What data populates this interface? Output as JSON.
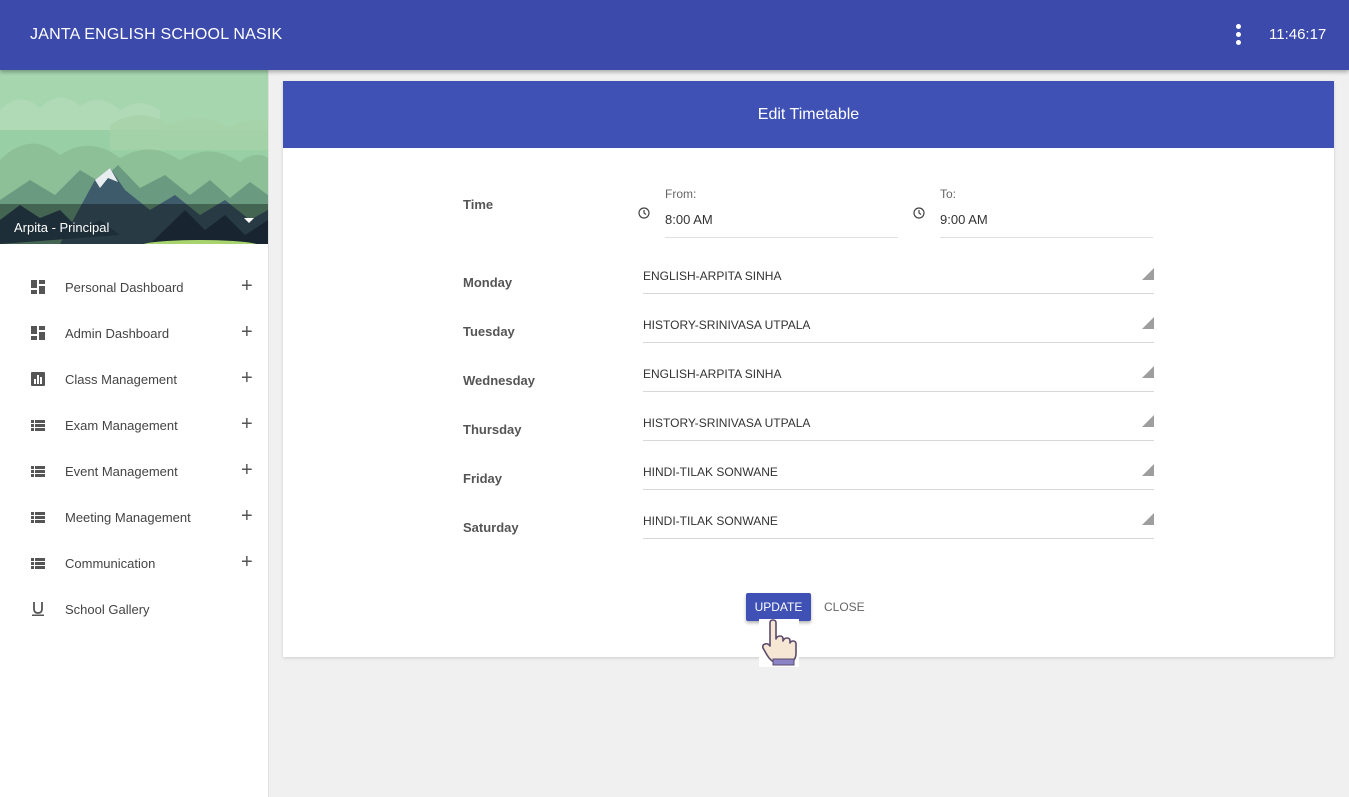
{
  "app": {
    "title": "JANTA ENGLISH SCHOOL NASIK",
    "time": "11:46:17"
  },
  "profile": {
    "name": "Arpita - Principal"
  },
  "sidebar": {
    "items": [
      {
        "label": "Personal Dashboard",
        "icon": "dashboard-icon",
        "expandable": true
      },
      {
        "label": "Admin Dashboard",
        "icon": "dashboard-grid-icon",
        "expandable": true
      },
      {
        "label": "Class Management",
        "icon": "chart-icon",
        "expandable": true
      },
      {
        "label": "Exam Management",
        "icon": "list-icon",
        "expandable": true
      },
      {
        "label": "Event Management",
        "icon": "list-icon",
        "expandable": true
      },
      {
        "label": "Meeting Management",
        "icon": "list-icon",
        "expandable": true
      },
      {
        "label": "Communication",
        "icon": "list-icon",
        "expandable": true
      },
      {
        "label": "School Gallery",
        "icon": "underline-icon",
        "expandable": false
      }
    ]
  },
  "dialog": {
    "title": "Edit Timetable",
    "time_label": "Time",
    "from": {
      "caption": "From:",
      "value": "8:00 AM"
    },
    "to": {
      "caption": "To:",
      "value": "9:00 AM"
    },
    "days": [
      {
        "day": "Monday",
        "value": "ENGLISH-ARPITA SINHA"
      },
      {
        "day": "Tuesday",
        "value": "HISTORY-SRINIVASA UTPALA"
      },
      {
        "day": "Wednesday",
        "value": "ENGLISH-ARPITA SINHA"
      },
      {
        "day": "Thursday",
        "value": "HISTORY-SRINIVASA UTPALA"
      },
      {
        "day": "Friday",
        "value": "HINDI-TILAK SONWANE"
      },
      {
        "day": "Saturday",
        "value": "HINDI-TILAK SONWANE"
      }
    ],
    "update_label": "UPDATE",
    "close_label": "CLOSE"
  },
  "colors": {
    "header": "#3b4aab",
    "accent": "#3f51b5"
  }
}
